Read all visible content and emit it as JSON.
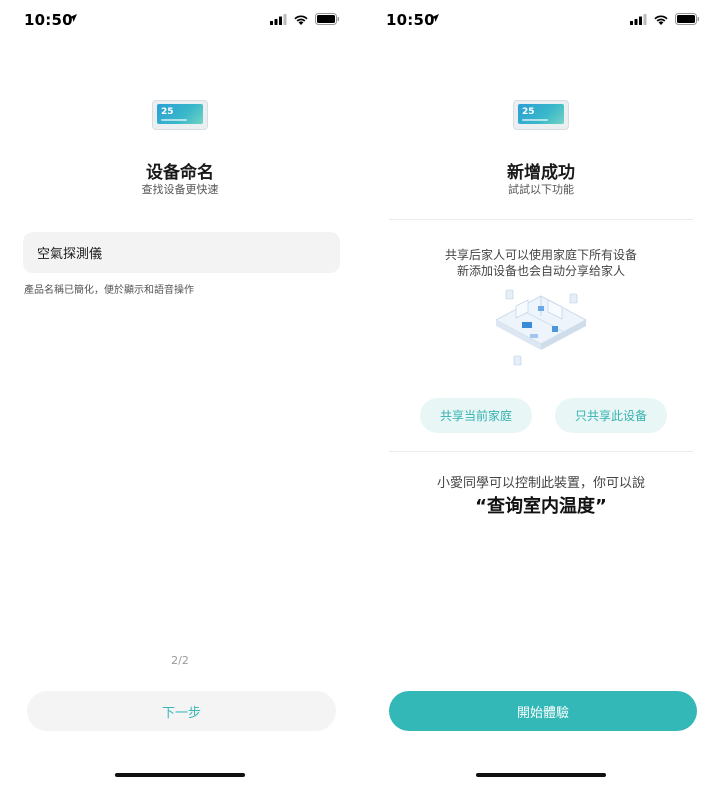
{
  "left_screen": {
    "status": {
      "time": "10:50"
    },
    "title": "设备命名",
    "subtitle": "查找设备更快速",
    "device_name_value": "空氣探測儀",
    "hint": "產品名稱已簡化，便於顯示和語音操作",
    "page_indicator": "2/2",
    "next_button": "下一步",
    "device_thumb_temp": "25"
  },
  "right_screen": {
    "status": {
      "time": "10:50"
    },
    "title": "新增成功",
    "subtitle": "試試以下功能",
    "share_line1": "共享后家人可以使用家庭下所有设备",
    "share_line2": "新添加设备也会自动分享给家人",
    "share_home_button": "共享当前家庭",
    "share_device_button": "只共享此设备",
    "voice_line": "小愛同學可以控制此裝置，你可以說",
    "voice_command": "“查询室内温度”",
    "start_button": "開始體驗",
    "device_thumb_temp": "25"
  },
  "colors": {
    "accent": "#33b7b7",
    "pill_bg": "#e8f7f6",
    "field_bg": "#f3f3f3"
  },
  "icons": [
    "location-arrow-icon",
    "cellular-signal-icon",
    "wifi-icon",
    "battery-icon"
  ]
}
